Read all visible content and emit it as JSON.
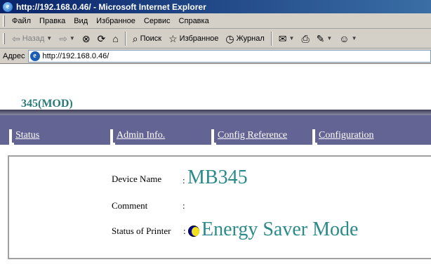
{
  "window": {
    "title": "http://192.168.0.46/ - Microsoft Internet Explorer"
  },
  "menu": [
    "Файл",
    "Правка",
    "Вид",
    "Избранное",
    "Сервис",
    "Справка"
  ],
  "toolbar": {
    "back": "Назад",
    "search": "Поиск",
    "favorites": "Избранное",
    "history": "Журнал"
  },
  "address": {
    "label": "Адрес",
    "url": "http://192.168.0.46/"
  },
  "page": {
    "title": "345(MOD)",
    "nav": [
      "Status",
      "Admin Info.",
      "Config Reference",
      "Configuration"
    ],
    "device_name_label": "Device Name",
    "device_name_value": "MB345",
    "comment_label": "Comment",
    "comment_value": "",
    "status_label": "Status of Printer",
    "status_value": "Energy Saver Mode",
    "colon": ":"
  },
  "colors": {
    "accent_teal": "#2b8a8a",
    "nav_band": "#636394"
  },
  "icons": [
    "ie-logo-icon",
    "back-icon",
    "forward-icon",
    "stop-icon",
    "refresh-icon",
    "home-icon",
    "search-icon",
    "favorites-icon",
    "history-icon",
    "mail-icon",
    "print-icon",
    "edit-icon",
    "messenger-icon",
    "energy-saver-icon"
  ]
}
